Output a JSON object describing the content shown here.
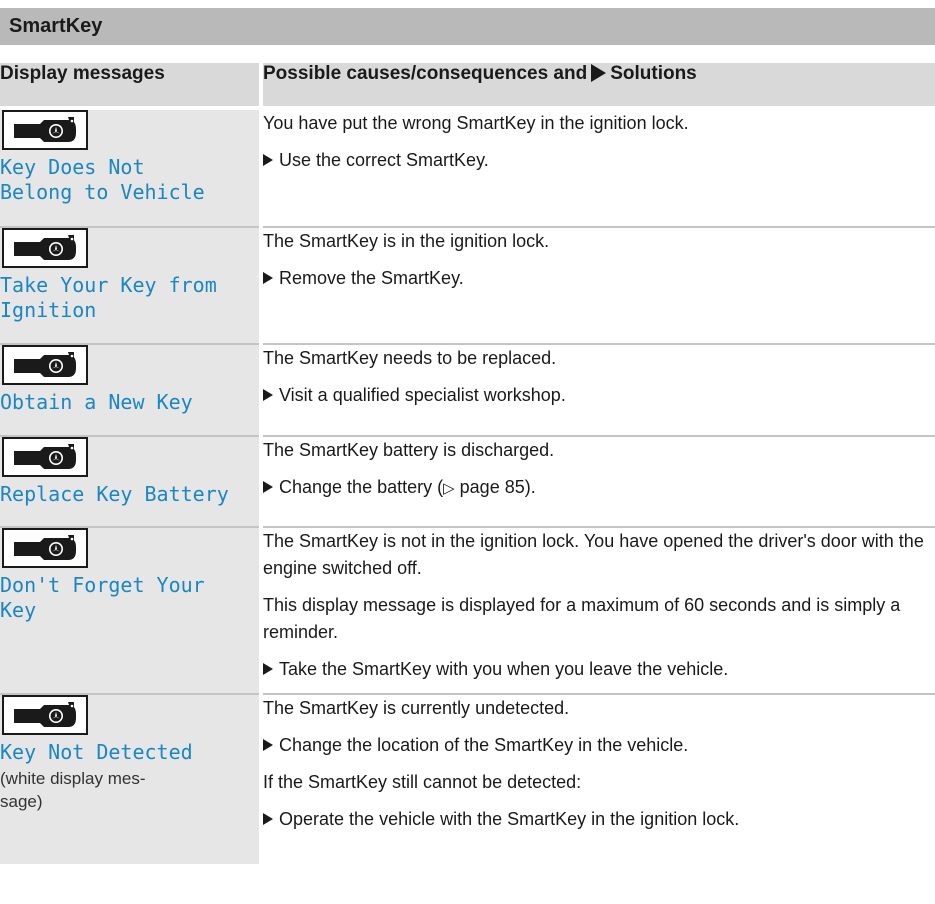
{
  "section": {
    "title": "SmartKey"
  },
  "table": {
    "col1_header": "Display messages",
    "col2_header_before": "Possible causes/consequences and",
    "col2_header_after": "Solutions",
    "rows": [
      {
        "display": "Key Does Not\nBelong to Vehicle",
        "causes": [
          "You have put the wrong SmartKey in the ignition lock."
        ],
        "action": "Use the correct SmartKey."
      },
      {
        "display": "Take Your Key from\nIgnition",
        "causes": [
          "The SmartKey is in the ignition lock."
        ],
        "action": "Remove the SmartKey."
      },
      {
        "display": "Obtain a New Key",
        "causes": [
          "The SmartKey needs to be replaced."
        ],
        "action": "Visit a qualified specialist workshop."
      },
      {
        "display": "Replace Key Battery",
        "causes": [
          "The SmartKey battery is discharged."
        ],
        "action_before": "Change the battery (",
        "action_ref": "▷",
        "action_after": " page 85)."
      },
      {
        "display": "Don't Forget Your\nKey",
        "causes": [
          "The SmartKey is not in the ignition lock. You have opened the driver's door with the engine switched off.",
          "This display message is displayed for a maximum of 60 seconds and is simply a reminder."
        ],
        "action": "Take the SmartKey with you when you leave the vehicle."
      },
      {
        "display": "Key Not Detected",
        "display_note": "(white display mes-\nsage)",
        "causes": [
          "The SmartKey is currently undetected."
        ],
        "action": "Change the location of the SmartKey in the vehicle.",
        "cause_after": "If the SmartKey still cannot be detected:",
        "action2": "Operate the vehicle with the SmartKey in the ignition lock."
      }
    ]
  },
  "icon": {
    "name": "smartkey-icon"
  }
}
